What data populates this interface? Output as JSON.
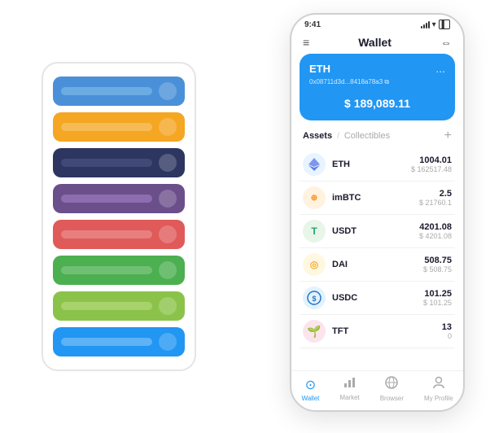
{
  "app": {
    "title": "Wallet"
  },
  "statusBar": {
    "time": "9:41",
    "signalBars": [
      3,
      5,
      7,
      9,
      11
    ],
    "wifi": "wifi",
    "battery": "battery"
  },
  "header": {
    "menuIcon": "≡",
    "title": "Wallet",
    "expandIcon": "⇔"
  },
  "ethCard": {
    "label": "ETH",
    "moreIcon": "...",
    "address": "0x08711d3d...8418a78a3",
    "copyIcon": "⧉",
    "balanceCurrency": "$ ",
    "balance": "189,089.11"
  },
  "assetsTabs": {
    "active": "Assets",
    "divider": "/",
    "inactive": "Collectibles",
    "addIcon": "+"
  },
  "tokens": [
    {
      "symbol": "ETH",
      "icon": "◈",
      "iconBg": "#e8f4ff",
      "iconColor": "#627eea",
      "amount": "1004.01",
      "usd": "$ 162517.48"
    },
    {
      "symbol": "imBTC",
      "icon": "⊕",
      "iconBg": "#fff3e0",
      "iconColor": "#f7931a",
      "amount": "2.5",
      "usd": "$ 21760.1"
    },
    {
      "symbol": "USDT",
      "icon": "T",
      "iconBg": "#e8f5e9",
      "iconColor": "#26a17b",
      "amount": "4201.08",
      "usd": "$ 4201.08"
    },
    {
      "symbol": "DAI",
      "icon": "D",
      "iconBg": "#fff8e1",
      "iconColor": "#f5ac37",
      "amount": "508.75",
      "usd": "$ 508.75"
    },
    {
      "symbol": "USDC",
      "icon": "©",
      "iconBg": "#e3f2fd",
      "iconColor": "#2775ca",
      "amount": "101.25",
      "usd": "$ 101.25"
    },
    {
      "symbol": "TFT",
      "icon": "🌱",
      "iconBg": "#fce4ec",
      "iconColor": "#e91e63",
      "amount": "13",
      "usd": "0"
    }
  ],
  "bottomNav": [
    {
      "id": "wallet",
      "icon": "◎",
      "label": "Wallet",
      "active": true
    },
    {
      "id": "market",
      "icon": "📊",
      "label": "Market",
      "active": false
    },
    {
      "id": "browser",
      "icon": "🌐",
      "label": "Browser",
      "active": false
    },
    {
      "id": "profile",
      "icon": "👤",
      "label": "My Profile",
      "active": false
    }
  ],
  "cardStack": [
    {
      "barClass": "bar-blue",
      "iconClass": "ci-blue"
    },
    {
      "barClass": "bar-orange",
      "iconClass": "ci-orange"
    },
    {
      "barClass": "bar-dark",
      "iconClass": "ci-dark"
    },
    {
      "barClass": "bar-purple",
      "iconClass": "ci-purple"
    },
    {
      "barClass": "bar-red",
      "iconClass": "ci-red"
    },
    {
      "barClass": "bar-green",
      "iconClass": "ci-green"
    },
    {
      "barClass": "bar-lightgreen",
      "iconClass": "ci-lightgreen"
    },
    {
      "barClass": "bar-blue2",
      "iconClass": "ci-blue2"
    }
  ]
}
